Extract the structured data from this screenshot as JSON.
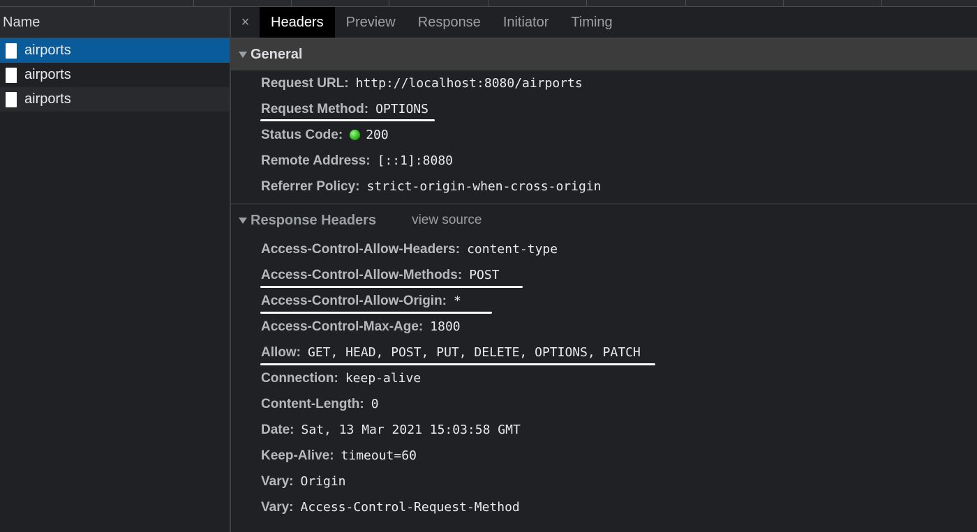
{
  "left_panel": {
    "header": "Name",
    "requests": [
      {
        "label": "airports"
      },
      {
        "label": "airports"
      },
      {
        "label": "airports"
      }
    ]
  },
  "tabs": {
    "close": "×",
    "items": [
      "Headers",
      "Preview",
      "Response",
      "Initiator",
      "Timing"
    ]
  },
  "general": {
    "title": "General",
    "rows": [
      {
        "key": "Request URL:",
        "value": "http://localhost:8080/airports"
      },
      {
        "key": "Request Method:",
        "value": "OPTIONS"
      },
      {
        "key": "Status Code:",
        "value": "200"
      },
      {
        "key": "Remote Address:",
        "value": "[::1]:8080"
      },
      {
        "key": "Referrer Policy:",
        "value": "strict-origin-when-cross-origin"
      }
    ]
  },
  "response_headers": {
    "title": "Response Headers",
    "view_source": "view source",
    "rows": [
      {
        "key": "Access-Control-Allow-Headers:",
        "value": "content-type"
      },
      {
        "key": "Access-Control-Allow-Methods:",
        "value": "POST"
      },
      {
        "key": "Access-Control-Allow-Origin:",
        "value": "*"
      },
      {
        "key": "Access-Control-Max-Age:",
        "value": "1800"
      },
      {
        "key": "Allow:",
        "value": "GET, HEAD, POST, PUT, DELETE, OPTIONS, PATCH"
      },
      {
        "key": "Connection:",
        "value": "keep-alive"
      },
      {
        "key": "Content-Length:",
        "value": "0"
      },
      {
        "key": "Date:",
        "value": "Sat, 13 Mar 2021 15:03:58 GMT"
      },
      {
        "key": "Keep-Alive:",
        "value": "timeout=60"
      },
      {
        "key": "Vary:",
        "value": "Origin"
      },
      {
        "key": "Vary:",
        "value": "Access-Control-Request-Method"
      }
    ]
  },
  "colors": {
    "selected_row": "#0a5b99",
    "status_ok": "#2ab517"
  }
}
